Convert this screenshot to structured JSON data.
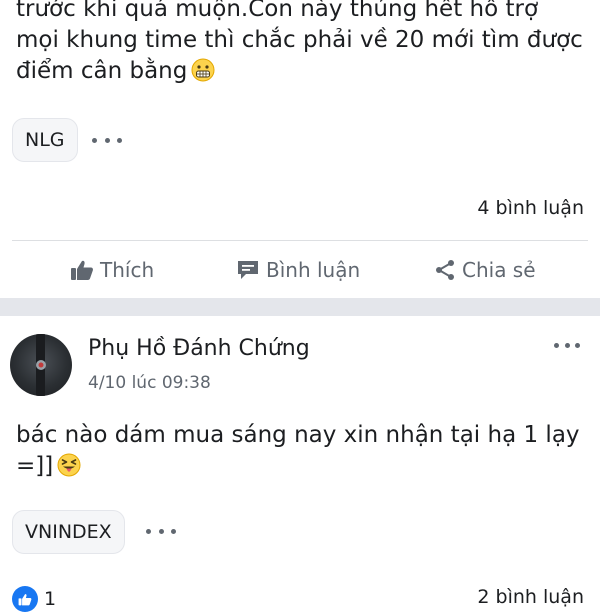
{
  "post1": {
    "text": "trước khi quá muộn.Con này thủng hết hỗ trợ mọi khung time thì chắc phải về 20 mới tìm được điểm cân bằng",
    "emoji": "grimacing-face",
    "tag": "NLG",
    "comment_count": "4 bình luận"
  },
  "actions": {
    "like": "Thích",
    "comment": "Bình luận",
    "share": "Chia sẻ"
  },
  "post2": {
    "author": "Phụ Hồ Đánh Chứng",
    "date": "4/10 lúc 09:38",
    "text": "bác nào dám mua sáng nay xin nhận tại hạ 1 lạy =]]",
    "emoji": "squinting-face-with-tongue",
    "tag": "VNINDEX",
    "like_count": "1",
    "comment_count": "2 bình luận"
  },
  "colors": {
    "accent": "#1877f2",
    "muted_text": "#606770",
    "separator": "#e4e6eb"
  }
}
